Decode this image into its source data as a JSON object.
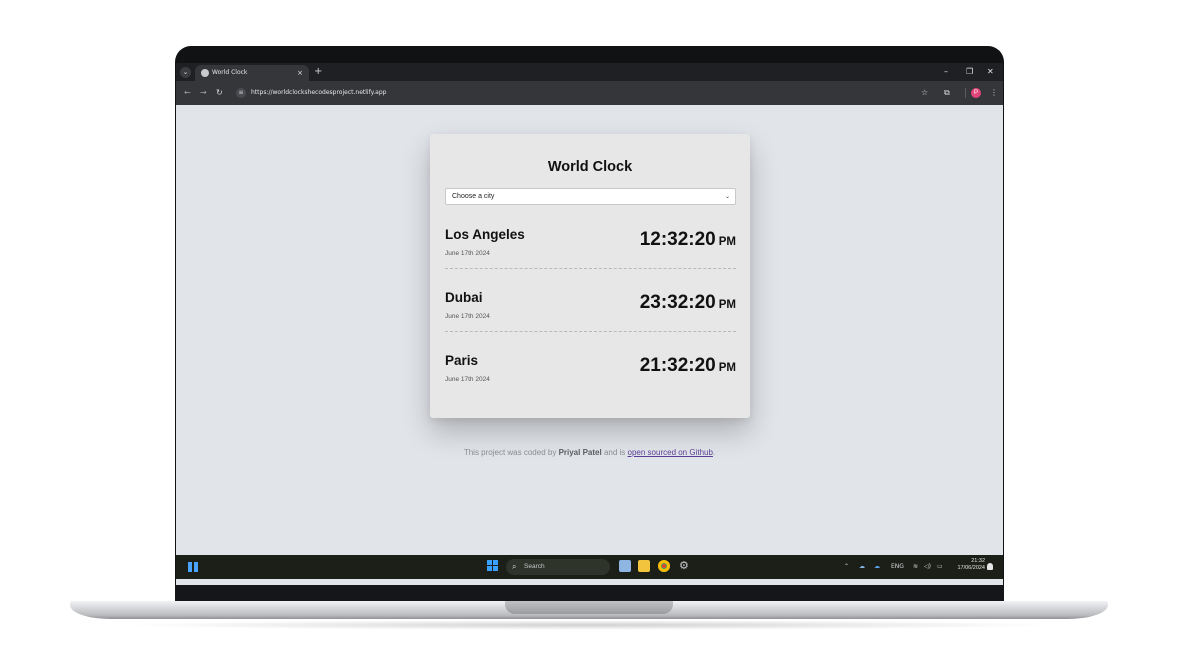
{
  "browser": {
    "tab_title": "World Clock",
    "tab_close": "×",
    "new_tab": "+",
    "url": "https://worldclockshecodesproject.netlify.app",
    "profile_initial": "P",
    "controls": {
      "minimize": "–",
      "restore": "❐",
      "close": "✕"
    }
  },
  "app": {
    "title": "World Clock",
    "select_value": "Choose a city",
    "cities": [
      {
        "name": "Los Angeles",
        "date": "June 17th 2024",
        "time": "12:32:20",
        "ampm": "PM"
      },
      {
        "name": "Dubai",
        "date": "June 17th 2024",
        "time": "23:32:20",
        "ampm": "PM"
      },
      {
        "name": "Paris",
        "date": "June 17th 2024",
        "time": "21:32:20",
        "ampm": "PM"
      }
    ],
    "footer": {
      "prefix": "This project was coded by",
      "author": "Priyal Patel",
      "middle": "and is",
      "link": "open sourced on Github",
      "suffix": "."
    }
  },
  "taskbar": {
    "search_placeholder": "Search",
    "language": "ENG",
    "clock_time": "21:32",
    "clock_date": "17/06/2024"
  },
  "colors": {
    "page_background": "#e1e4e9",
    "card_background": "#e7e7e7",
    "link": "#5a3e96",
    "profile": "#e1457a",
    "windows_accent": "#3aa0ff"
  }
}
